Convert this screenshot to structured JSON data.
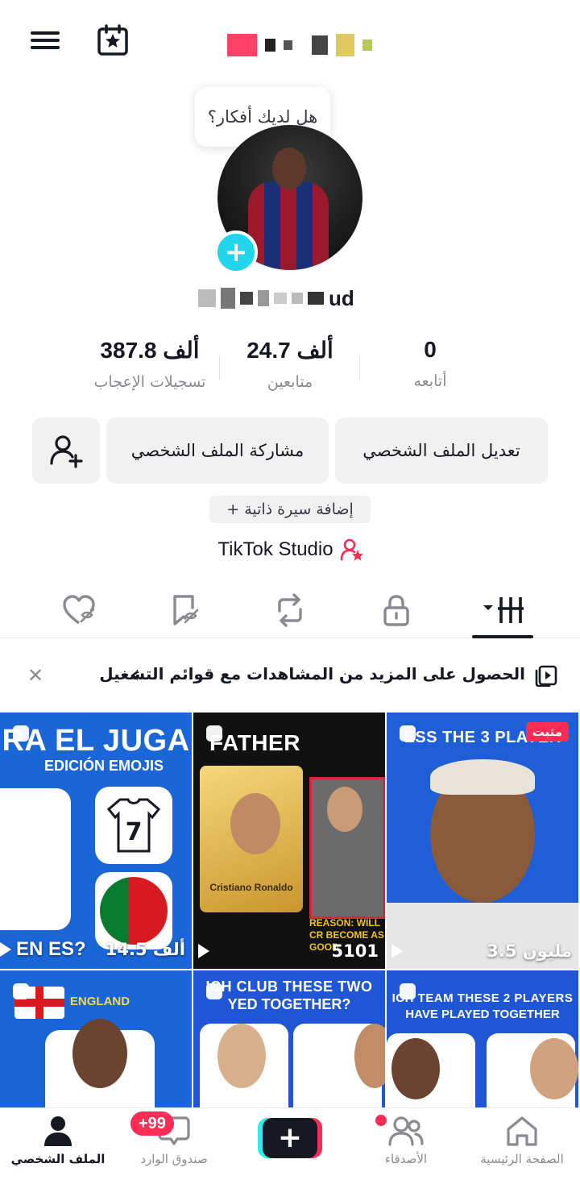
{
  "header": {
    "menu_icon": "hamburger-menu-icon",
    "calendar_icon": "calendar-star-icon"
  },
  "profile": {
    "bubble_text": "هل لديك أفكار؟",
    "handle_visible": "ud",
    "stats": [
      {
        "value": "0",
        "label": "أتابعه"
      },
      {
        "value": "24.7 ألف",
        "label": "متابعين"
      },
      {
        "value": "387.8 ألف",
        "label": "تسجيلات الإعجاب"
      }
    ]
  },
  "actions": {
    "edit_profile": "تعديل الملف الشخصي",
    "share_profile": "مشاركة الملف الشخصي",
    "add_bio": "+ إضافة سيرة ذاتية",
    "studio": "TikTok Studio"
  },
  "playlist_banner": {
    "text": "الحصول على المزيد من المشاهدات مع قوائم التشغيل",
    "chevron": "‹"
  },
  "videos": [
    {
      "headline": "RA EL JUGA",
      "sub": "EDICIÓN EMOJIS",
      "tag": "EN ES?",
      "views": "14.5 ألف"
    },
    {
      "headline": "FATHER",
      "sub": "Cristiano Ronaldo",
      "tag": "REASON: WILL CR BECOME AS GOOD",
      "views": "5101"
    },
    {
      "headline": "ESS THE 3 PLAYER",
      "views": "3.5 مليون",
      "pinned": "مثبت"
    },
    {
      "headline": "",
      "sub": "ENGLAND"
    },
    {
      "headline": "ICH CLUB THESE TWO",
      "sub": "YED TOGETHER?"
    },
    {
      "headline": "ICH TEAM THESE 2 PLAYERS",
      "sub": "HAVE PLAYED TOGETHER"
    }
  ],
  "bottom_nav": {
    "home": "الصفحة الرئيسية",
    "friends": "الأصدقاء",
    "inbox": "صندوق الوارد",
    "inbox_badge": "+99",
    "profile": "الملف الشخصي"
  },
  "colors": {
    "accent": "#fe2c55",
    "cyan": "#20d5ec",
    "text": "#161823",
    "muted": "#8a8b91"
  }
}
